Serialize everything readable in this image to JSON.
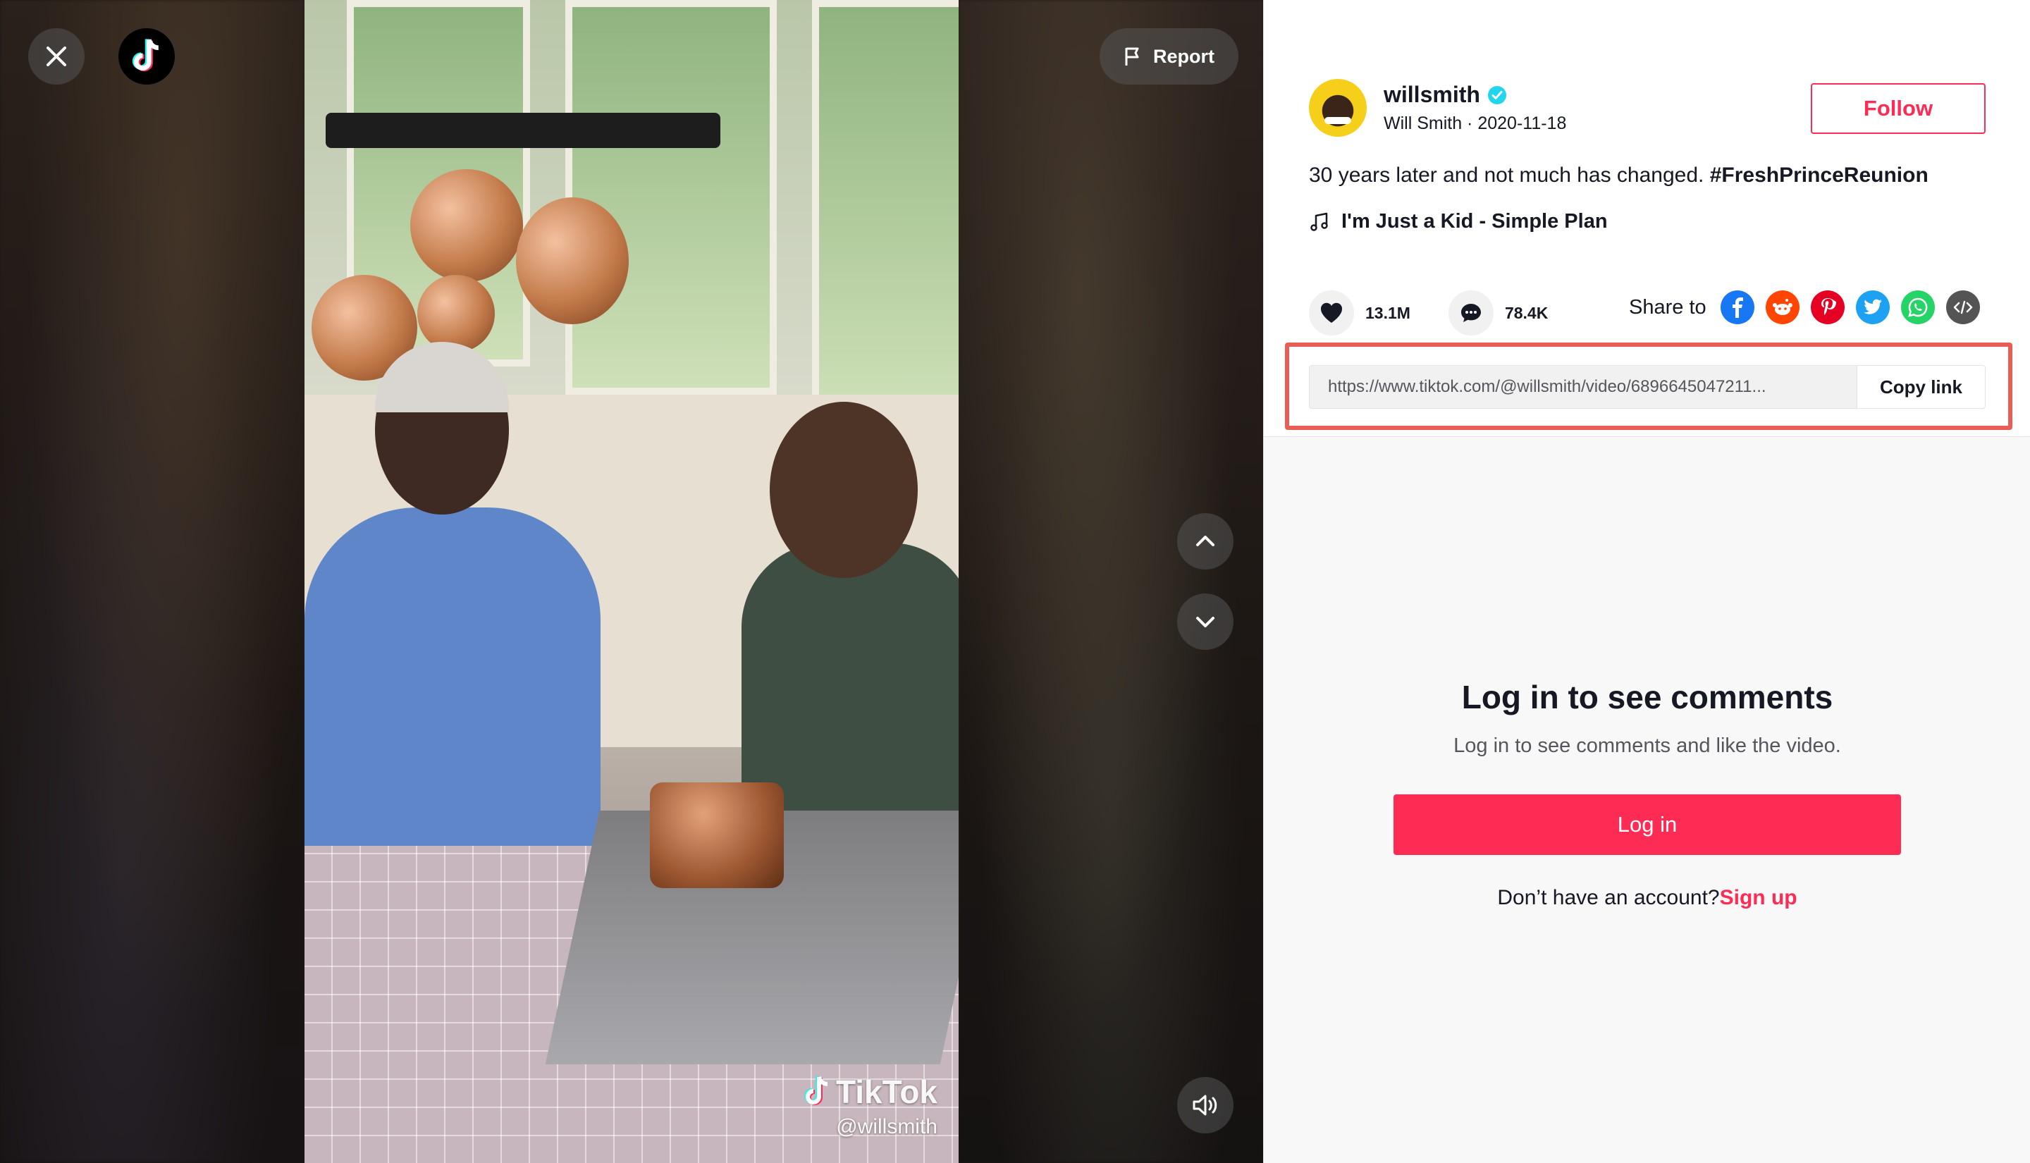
{
  "video": {
    "watermark_brand": "TikTok",
    "watermark_handle": "@willsmith"
  },
  "controls": {
    "close_icon": "close-icon",
    "logo_icon": "tiktok-logo-icon",
    "report_label": "Report",
    "nav_up_icon": "chevron-up-icon",
    "nav_down_icon": "chevron-down-icon",
    "mute_icon": "volume-icon"
  },
  "author": {
    "username": "willsmith",
    "display_name": "Will Smith",
    "date": "2020-11-18",
    "separator": " · ",
    "verified": true
  },
  "follow_label": "Follow",
  "caption": {
    "text": "30 years later and not much has changed. ",
    "hashtag": "#FreshPrinceReunion"
  },
  "music": "I'm Just a Kid - Simple Plan",
  "stats": {
    "likes": "13.1M",
    "comments": "78.4K"
  },
  "share": {
    "label": "Share to",
    "targets": [
      "facebook-icon",
      "reddit-icon",
      "pinterest-icon",
      "twitter-icon",
      "whatsapp-icon",
      "embed-icon"
    ]
  },
  "link": {
    "url": "https://www.tiktok.com/@willsmith/video/6896645047211...",
    "copy_label": "Copy link"
  },
  "comments_gate": {
    "title": "Log in to see comments",
    "subtitle": "Log in to see comments and like the video.",
    "login_label": "Log in",
    "no_account": "Don’t have an account?",
    "signup_label": "Sign up"
  },
  "colors": {
    "brand_red": "#fe2c55",
    "highlight": "#ea5d55",
    "verified": "#20d5ec"
  }
}
